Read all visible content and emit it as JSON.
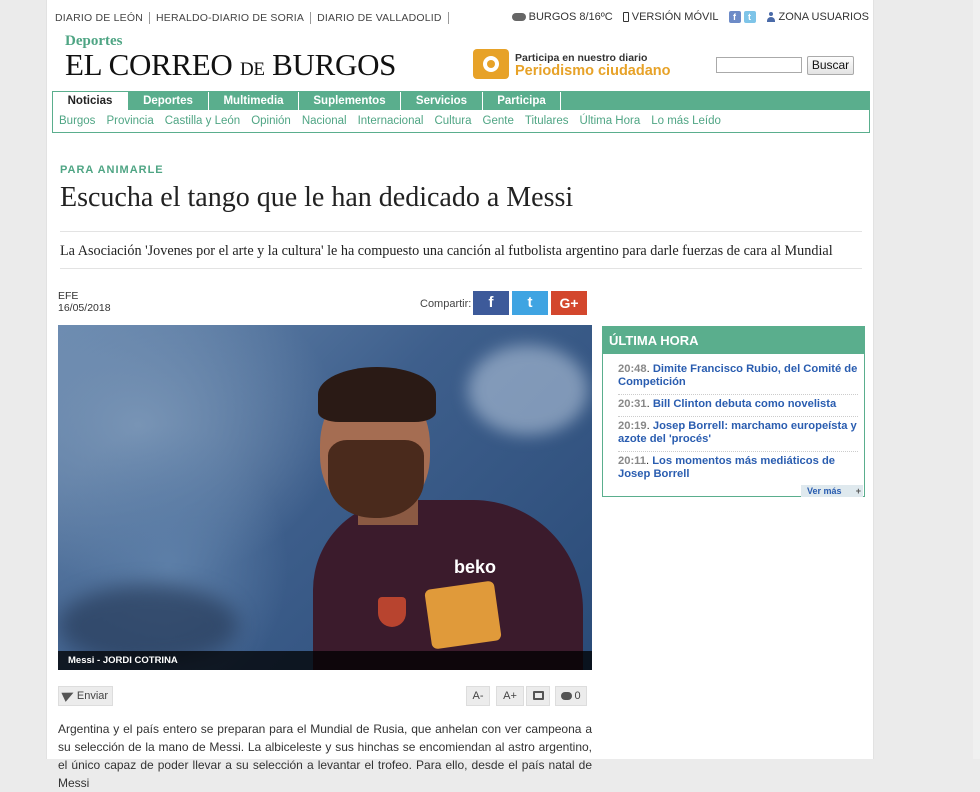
{
  "sister_sites": [
    "DIARIO DE LEÓN",
    "HERALDO-DIARIO DE SORIA",
    "DIARIO DE VALLADOLID"
  ],
  "weather": "BURGOS 8/16ºC",
  "mobile_version": "VERSIÓN MÓVIL",
  "social": [
    "facebook-icon",
    "twitter-icon"
  ],
  "user_zone": "ZONA USUARIOS",
  "section_name": "Deportes",
  "logo": {
    "main1": "EL CORREO ",
    "de": "DE",
    "main2": " BURGOS"
  },
  "promo": {
    "small": "Participa en nuestro diario",
    "big": "Periodismo ciudadano"
  },
  "search": {
    "placeholder": "",
    "button": "Buscar"
  },
  "nav": {
    "tabs": [
      "Noticias",
      "Deportes",
      "Multimedia",
      "Suplementos",
      "Servicios",
      "Participa"
    ],
    "subnav": [
      "Burgos",
      "Provincia",
      "Castilla y León",
      "Opinión",
      "Nacional",
      "Internacional",
      "Cultura",
      "Gente",
      "Titulares",
      "Última Hora",
      "Lo más Leído"
    ]
  },
  "article": {
    "kicker": "PARA ANIMARLE",
    "headline": "Escucha el tango que le han dedicado a Messi",
    "subtitle": "La Asociación 'Jovenes por el arte y la cultura' le ha compuesto una canción al futbolista argentino para darle fuerzas de cara al Mundial",
    "source": "EFE",
    "date": "16/05/2018",
    "share_label": "Compartir:",
    "share": {
      "fb": "f",
      "tw": "t",
      "gp": "G+"
    },
    "photo_caption": "Messi - JORDI COTRINA",
    "jersey_text": "beko",
    "tools": {
      "send": "Enviar",
      "aminus": "A-",
      "aplus": "A+",
      "comments": "0"
    },
    "body": "Argentina y el país entero se preparan para el Mundial de Rusia, que anhelan con ver campeona a su selección de la mano de Messi. La albiceleste y sus hinchas se encomiendan al astro argentino, el único capaz de poder llevar a su selección a levantar el trofeo. Para ello, desde el país natal de Messi"
  },
  "sidebar": {
    "title": "ÚLTIMA HORA",
    "items": [
      {
        "time": "20:48",
        "title": "Dimite Francisco Rubio, del Comité de Competición"
      },
      {
        "time": "20:31",
        "title": "Bill Clinton debuta como novelista"
      },
      {
        "time": "20:19",
        "title": "Josep Borrell: marchamo europeísta y azote del 'procés'"
      },
      {
        "time": "20:11",
        "title": "Los momentos más mediáticos de Josep Borrell"
      }
    ],
    "more": "Ver más",
    "more_plus": "+"
  }
}
